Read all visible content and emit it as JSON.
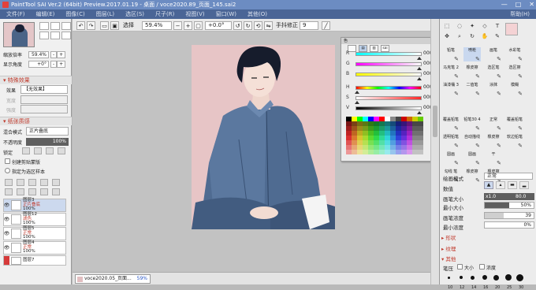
{
  "window": {
    "title": "PaintTool SAI Ver.2 (64bit) Preview.2017.01.19 - 桌面 / voce2020.89_页面_145.sai2",
    "controls": [
      "—",
      "□",
      "✕"
    ]
  },
  "menu": {
    "items": [
      "文件(F)",
      "编辑(E)",
      "图像(C)",
      "图层(L)",
      "选区(S)",
      "尺子(R)",
      "视图(V)",
      "窗口(W)",
      "其他(O)"
    ],
    "help": "帮助(H)"
  },
  "navigator": {
    "zoom_label": "缩放倍率",
    "zoom_value": "59.4%",
    "rotate_label": "显示角度",
    "rotate_value": "+0°"
  },
  "special_effects": {
    "header": "特殊效果",
    "effect_label": "效果",
    "effect_value": "【无效果】",
    "width_label": "宽度",
    "strength_label": "强度"
  },
  "layer_panel": {
    "header": "纸张质感",
    "blend_label": "混合模式",
    "blend_value": "正片叠底",
    "opacity_label": "不透明度",
    "opacity_value": "100%",
    "lock_label": "锁定",
    "clip_label": "创建剪贴蒙版",
    "sel_source_label": "指定为选区样本",
    "layers": [
      {
        "name": "图层3",
        "mode": "正片叠底",
        "opacity": "100%",
        "selected": true
      },
      {
        "name": "图层12",
        "mode": "滤色",
        "opacity": "100%",
        "selected": false
      },
      {
        "name": "图层5",
        "mode": "正常",
        "opacity": "100%",
        "selected": false
      },
      {
        "name": "图层4",
        "mode": "正常",
        "opacity": "100%",
        "selected": false
      },
      {
        "name": "图层7",
        "mode": "",
        "opacity": "",
        "selected": false
      }
    ]
  },
  "toolbar": {
    "selection_label": "选择",
    "zoom_value": "59.4%",
    "angle_value": "+0.0°",
    "stabilizer_label": "手抖修正",
    "stabilizer_value": "9"
  },
  "document_tab": {
    "name": "voce2020.05_页面...",
    "zoom": "59%"
  },
  "color_panel": {
    "title": "色",
    "mode_labels": [
      "",
      "",
      "",
      "sai"
    ],
    "sliders": [
      {
        "label": "R",
        "value": "000",
        "knob": 0.97,
        "gradient": "linear-gradient(90deg,#00ffff,#ffffff)"
      },
      {
        "label": "G",
        "value": "000",
        "knob": 0.97,
        "gradient": "linear-gradient(90deg,#ff00ff,#ffffff)"
      },
      {
        "label": "B",
        "value": "000",
        "knob": 0.97,
        "gradient": "linear-gradient(90deg,#ffff00,#ffffff)"
      },
      {
        "label": "H",
        "value": "000",
        "knob": 0.02,
        "gradient": "linear-gradient(90deg,#f00,#ff0,#0f0,#0ff,#00f,#f0f,#f00)"
      },
      {
        "label": "S",
        "value": "000",
        "knob": 0.02,
        "gradient": "linear-gradient(90deg,#ffffff,#ff2a2a)"
      },
      {
        "label": "V",
        "value": "000",
        "knob": 0.97,
        "gradient": "linear-gradient(90deg,#000000,#ffffff)"
      }
    ]
  },
  "right_panel": {
    "tool_icons": [
      "select-rect-icon",
      "lasso-icon",
      "wand-icon",
      "text-icon",
      "move-icon",
      "zoom-icon",
      "rotate-icon",
      "hand-icon",
      "eyedropper-icon"
    ],
    "brushes": [
      {
        "label": "铅笔",
        "selected": false
      },
      {
        "label": "喷枪",
        "selected": true
      },
      {
        "label": "画笔",
        "selected": false
      },
      {
        "label": "水彩笔",
        "selected": false
      },
      {
        "label": "马克笔 2",
        "selected": false
      },
      {
        "label": "橡皮擦",
        "selected": false
      },
      {
        "label": "选区笔",
        "selected": false
      },
      {
        "label": "选区擦",
        "selected": false
      },
      {
        "label": "油漆桶 3",
        "selected": false
      },
      {
        "label": "二值笔",
        "selected": false
      },
      {
        "label": "涂抹",
        "selected": false
      },
      {
        "label": "模糊",
        "selected": false
      },
      {
        "label": "",
        "selected": false
      },
      {
        "label": "",
        "selected": false
      },
      {
        "label": "",
        "selected": false
      },
      {
        "label": "",
        "selected": false
      },
      {
        "label": "覆盖铅笔",
        "selected": false
      },
      {
        "label": "铅笔30 4",
        "selected": false
      },
      {
        "label": "正常",
        "selected": false
      },
      {
        "label": "覆盖铅笔",
        "selected": false
      },
      {
        "label": "透明铅笔",
        "selected": false
      },
      {
        "label": "自动描线",
        "selected": false
      },
      {
        "label": "橡皮擦",
        "selected": false
      },
      {
        "label": "软边铅笔",
        "selected": false
      },
      {
        "label": "圆画",
        "selected": false
      },
      {
        "label": "圆画",
        "selected": false
      },
      {
        "label": "干",
        "selected": false
      },
      {
        "label": "",
        "selected": false
      },
      {
        "label": "勾线 笔",
        "selected": false
      },
      {
        "label": "橡皮擦",
        "selected": false
      },
      {
        "label": "橡皮擦",
        "selected": false
      },
      {
        "label": "",
        "selected": false
      }
    ],
    "blend_label": "绘画模式",
    "blend_value": "正常",
    "shape_label": "数值",
    "size_label": "画笔大小",
    "size_mult": "x1.0",
    "size_value": "80.0",
    "min_size_label": "最小大小",
    "min_size_value": "50%",
    "density_label": "画笔浓度",
    "density_value": "39",
    "min_density_label": "最小浓度",
    "min_density_value": "0%",
    "sect_shape": "形状",
    "sect_texture": "纹理",
    "sect_other": "其他",
    "pressure_label": "笔压",
    "pressure_size": "大小",
    "pressure_density": "浓度",
    "dot_sizes": [
      "10",
      "12",
      "14",
      "16",
      "20",
      "25",
      "30"
    ]
  }
}
